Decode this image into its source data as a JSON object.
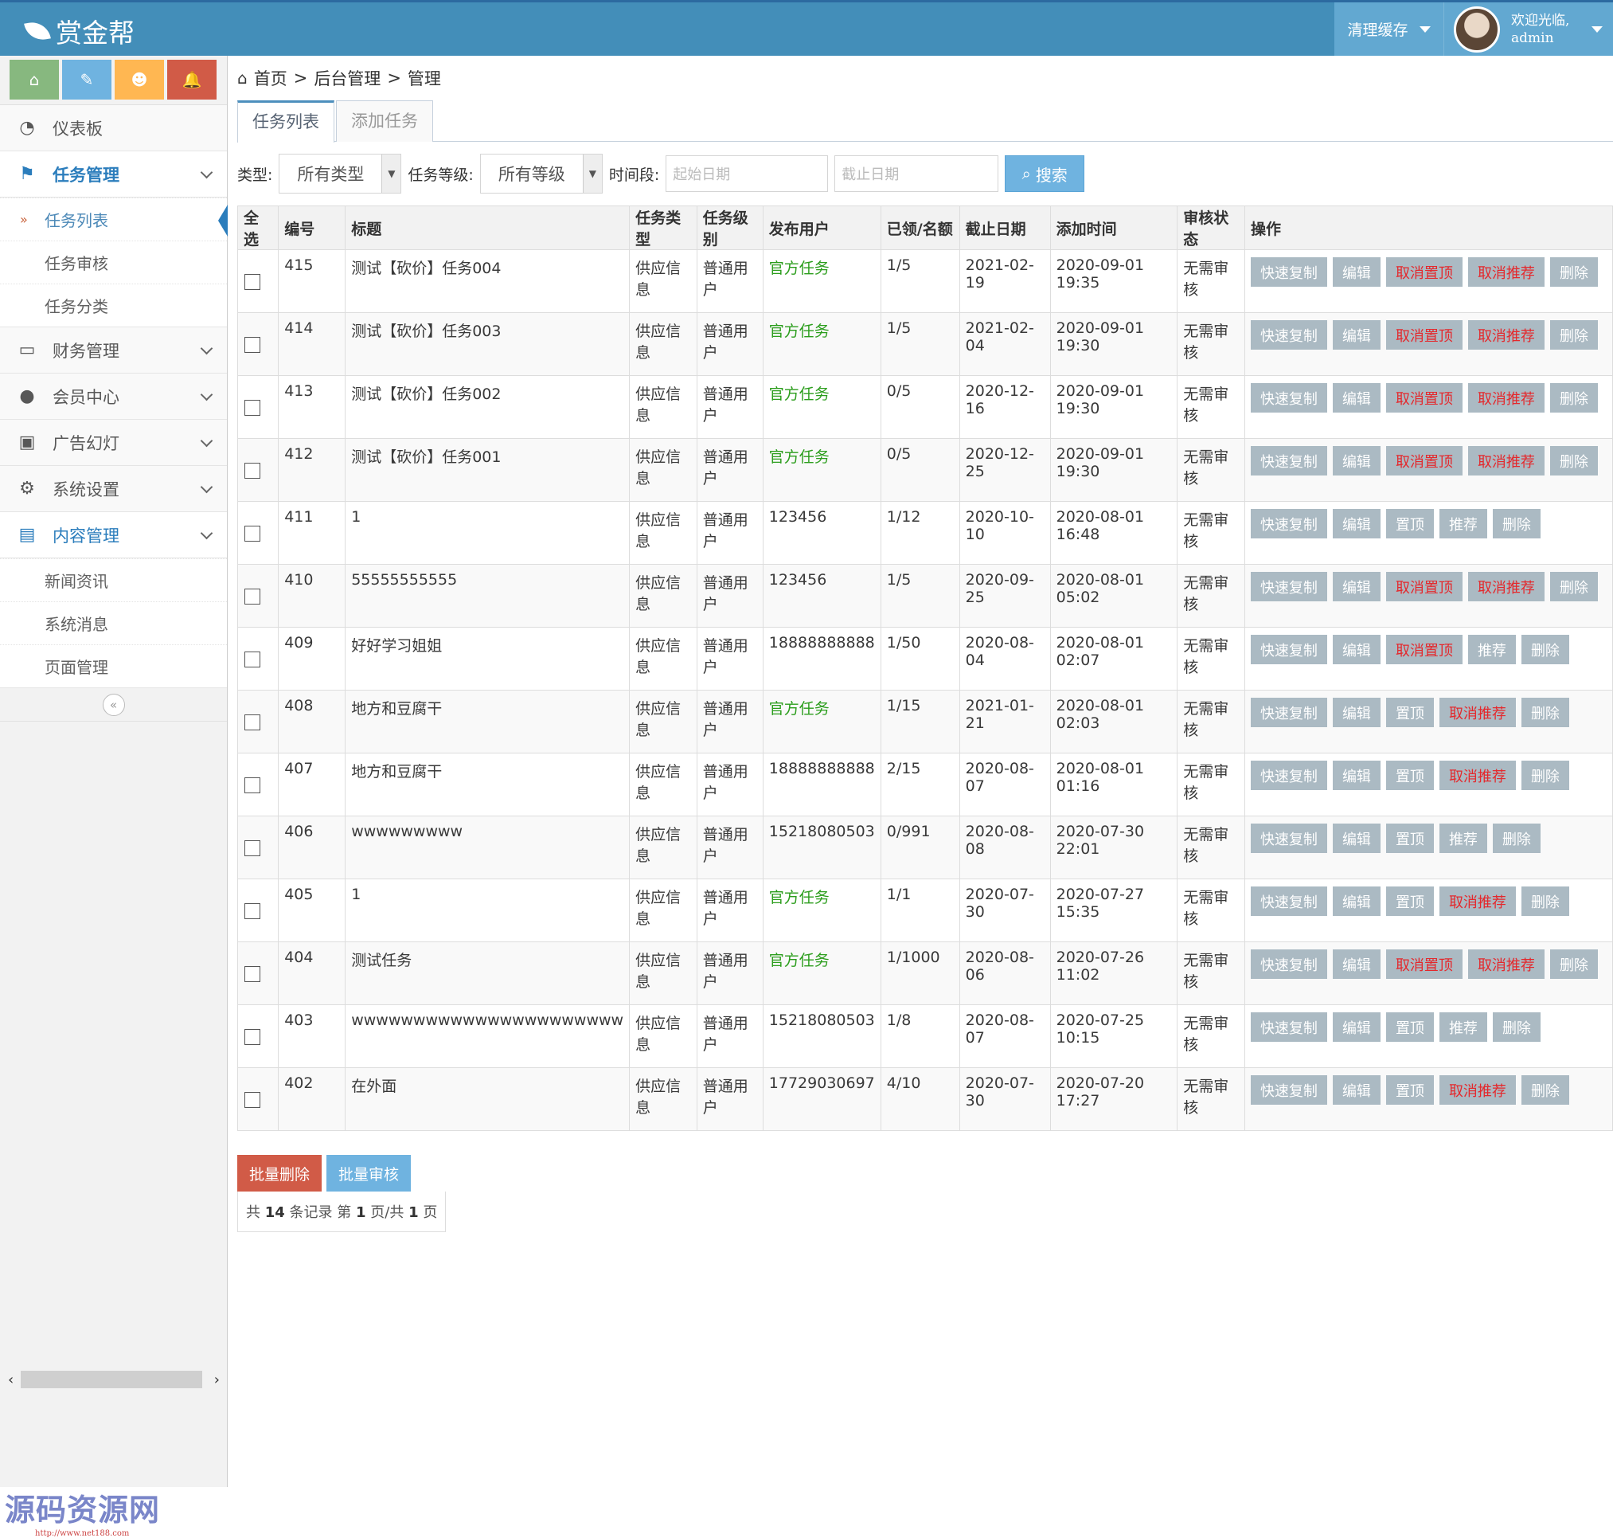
{
  "navbar": {
    "brand": "赏金帮",
    "clear_cache": "清理缓存",
    "welcome": "欢迎光临,",
    "username": "admin",
    "colors": {
      "bar": "#438eb9",
      "item": "#62a8d1"
    }
  },
  "shortcuts": [
    {
      "icon": "home-icon",
      "glyph": "⌂",
      "color": "#87b87f"
    },
    {
      "icon": "pencil-icon",
      "glyph": "✎",
      "color": "#6fb3e0"
    },
    {
      "icon": "users-icon",
      "glyph": "☻",
      "color": "#ffb752"
    },
    {
      "icon": "bell-icon",
      "glyph": "🔔",
      "color": "#d15b47"
    }
  ],
  "sidebar": {
    "dashboard": "仪表板",
    "task_mgmt": "任务管理",
    "task_sub": [
      "任务列表",
      "任务审核",
      "任务分类"
    ],
    "finance": "财务管理",
    "members": "会员中心",
    "ads": "广告幻灯",
    "settings": "系统设置",
    "content": "内容管理",
    "content_sub": [
      "新闻资讯",
      "系统消息",
      "页面管理"
    ],
    "collapse": "«"
  },
  "breadcrumb": {
    "home": "首页",
    "admin": "后台管理",
    "current": "管理",
    "sep": ">"
  },
  "tabs": [
    "任务列表",
    "添加任务"
  ],
  "filters": {
    "type_label": "类型:",
    "type_value": "所有类型",
    "level_label": "任务等级:",
    "level_value": "所有等级",
    "period_label": "时间段:",
    "start_placeholder": "起始日期",
    "end_placeholder": "截止日期",
    "search": "搜索"
  },
  "table": {
    "headers": [
      "全选",
      "编号",
      "标题",
      "任务类型",
      "任务级别",
      "发布用户",
      "已领/名额",
      "截止日期",
      "添加时间",
      "审核状态",
      "操作"
    ],
    "rows": [
      {
        "id": "415",
        "title": "测试【砍价】任务004",
        "type": "供应信息",
        "level": "普通用户",
        "user": "官方任务",
        "quota": "1/5",
        "deadline": "2021-02-19",
        "added": "2020-09-01 19:35",
        "status": "无需审核",
        "ops": [
          "快速复制",
          "编辑",
          "取消置顶",
          "取消推荐",
          "删除"
        ]
      },
      {
        "id": "414",
        "title": "测试【砍价】任务003",
        "type": "供应信息",
        "level": "普通用户",
        "user": "官方任务",
        "quota": "1/5",
        "deadline": "2021-02-04",
        "added": "2020-09-01 19:30",
        "status": "无需审核",
        "ops": [
          "快速复制",
          "编辑",
          "取消置顶",
          "取消推荐",
          "删除"
        ]
      },
      {
        "id": "413",
        "title": "测试【砍价】任务002",
        "type": "供应信息",
        "level": "普通用户",
        "user": "官方任务",
        "quota": "0/5",
        "deadline": "2020-12-16",
        "added": "2020-09-01 19:30",
        "status": "无需审核",
        "ops": [
          "快速复制",
          "编辑",
          "取消置顶",
          "取消推荐",
          "删除"
        ]
      },
      {
        "id": "412",
        "title": "测试【砍价】任务001",
        "type": "供应信息",
        "level": "普通用户",
        "user": "官方任务",
        "quota": "0/5",
        "deadline": "2020-12-25",
        "added": "2020-09-01 19:30",
        "status": "无需审核",
        "ops": [
          "快速复制",
          "编辑",
          "取消置顶",
          "取消推荐",
          "删除"
        ]
      },
      {
        "id": "411",
        "title": "1",
        "type": "供应信息",
        "level": "普通用户",
        "user": "123456",
        "quota": "1/12",
        "deadline": "2020-10-10",
        "added": "2020-08-01 16:48",
        "status": "无需审核",
        "ops": [
          "快速复制",
          "编辑",
          "置顶",
          "推荐",
          "删除"
        ]
      },
      {
        "id": "410",
        "title": "55555555555",
        "type": "供应信息",
        "level": "普通用户",
        "user": "123456",
        "quota": "1/5",
        "deadline": "2020-09-25",
        "added": "2020-08-01 05:02",
        "status": "无需审核",
        "ops": [
          "快速复制",
          "编辑",
          "取消置顶",
          "取消推荐",
          "删除"
        ]
      },
      {
        "id": "409",
        "title": "好好学习姐姐",
        "type": "供应信息",
        "level": "普通用户",
        "user": "18888888888",
        "quota": "1/50",
        "deadline": "2020-08-04",
        "added": "2020-08-01 02:07",
        "status": "无需审核",
        "ops": [
          "快速复制",
          "编辑",
          "取消置顶",
          "推荐",
          "删除"
        ]
      },
      {
        "id": "408",
        "title": "地方和豆腐干",
        "type": "供应信息",
        "level": "普通用户",
        "user": "官方任务",
        "quota": "1/15",
        "deadline": "2021-01-21",
        "added": "2020-08-01 02:03",
        "status": "无需审核",
        "ops": [
          "快速复制",
          "编辑",
          "置顶",
          "取消推荐",
          "删除"
        ]
      },
      {
        "id": "407",
        "title": "地方和豆腐干",
        "type": "供应信息",
        "level": "普通用户",
        "user": "18888888888",
        "quota": "2/15",
        "deadline": "2020-08-07",
        "added": "2020-08-01 01:16",
        "status": "无需审核",
        "ops": [
          "快速复制",
          "编辑",
          "置顶",
          "取消推荐",
          "删除"
        ]
      },
      {
        "id": "406",
        "title": "wwwwwwwww",
        "type": "供应信息",
        "level": "普通用户",
        "user": "15218080503",
        "quota": "0/991",
        "deadline": "2020-08-08",
        "added": "2020-07-30 22:01",
        "status": "无需审核",
        "ops": [
          "快速复制",
          "编辑",
          "置顶",
          "推荐",
          "删除"
        ]
      },
      {
        "id": "405",
        "title": "1",
        "type": "供应信息",
        "level": "普通用户",
        "user": "官方任务",
        "quota": "1/1",
        "deadline": "2020-07-30",
        "added": "2020-07-27 15:35",
        "status": "无需审核",
        "ops": [
          "快速复制",
          "编辑",
          "置顶",
          "取消推荐",
          "删除"
        ]
      },
      {
        "id": "404",
        "title": "测试任务",
        "type": "供应信息",
        "level": "普通用户",
        "user": "官方任务",
        "quota": "1/1000",
        "deadline": "2020-08-06",
        "added": "2020-07-26 11:02",
        "status": "无需审核",
        "ops": [
          "快速复制",
          "编辑",
          "取消置顶",
          "取消推荐",
          "删除"
        ]
      },
      {
        "id": "403",
        "title": "wwwwwwwwwwwwwwwwwwwwww",
        "type": "供应信息",
        "level": "普通用户",
        "user": "15218080503",
        "quota": "1/8",
        "deadline": "2020-08-07",
        "added": "2020-07-25 10:15",
        "status": "无需审核",
        "ops": [
          "快速复制",
          "编辑",
          "置顶",
          "推荐",
          "删除"
        ]
      },
      {
        "id": "402",
        "title": "在外面",
        "type": "供应信息",
        "level": "普通用户",
        "user": "17729030697",
        "quota": "4/10",
        "deadline": "2020-07-30",
        "added": "2020-07-20 17:27",
        "status": "无需审核",
        "ops": [
          "快速复制",
          "编辑",
          "置顶",
          "取消推荐",
          "删除"
        ]
      }
    ]
  },
  "batch": {
    "delete": "批量删除",
    "review": "批量审核",
    "delete_color": "#d15b47",
    "review_color": "#6fb3e0"
  },
  "pager": {
    "prefix": "共",
    "total": "14",
    "records": "条记录 第",
    "page": "1",
    "mid": "页/共",
    "pages": "1",
    "suffix": "页"
  },
  "watermark": {
    "text": "源码资源网",
    "url": "http://www.net188.com"
  }
}
